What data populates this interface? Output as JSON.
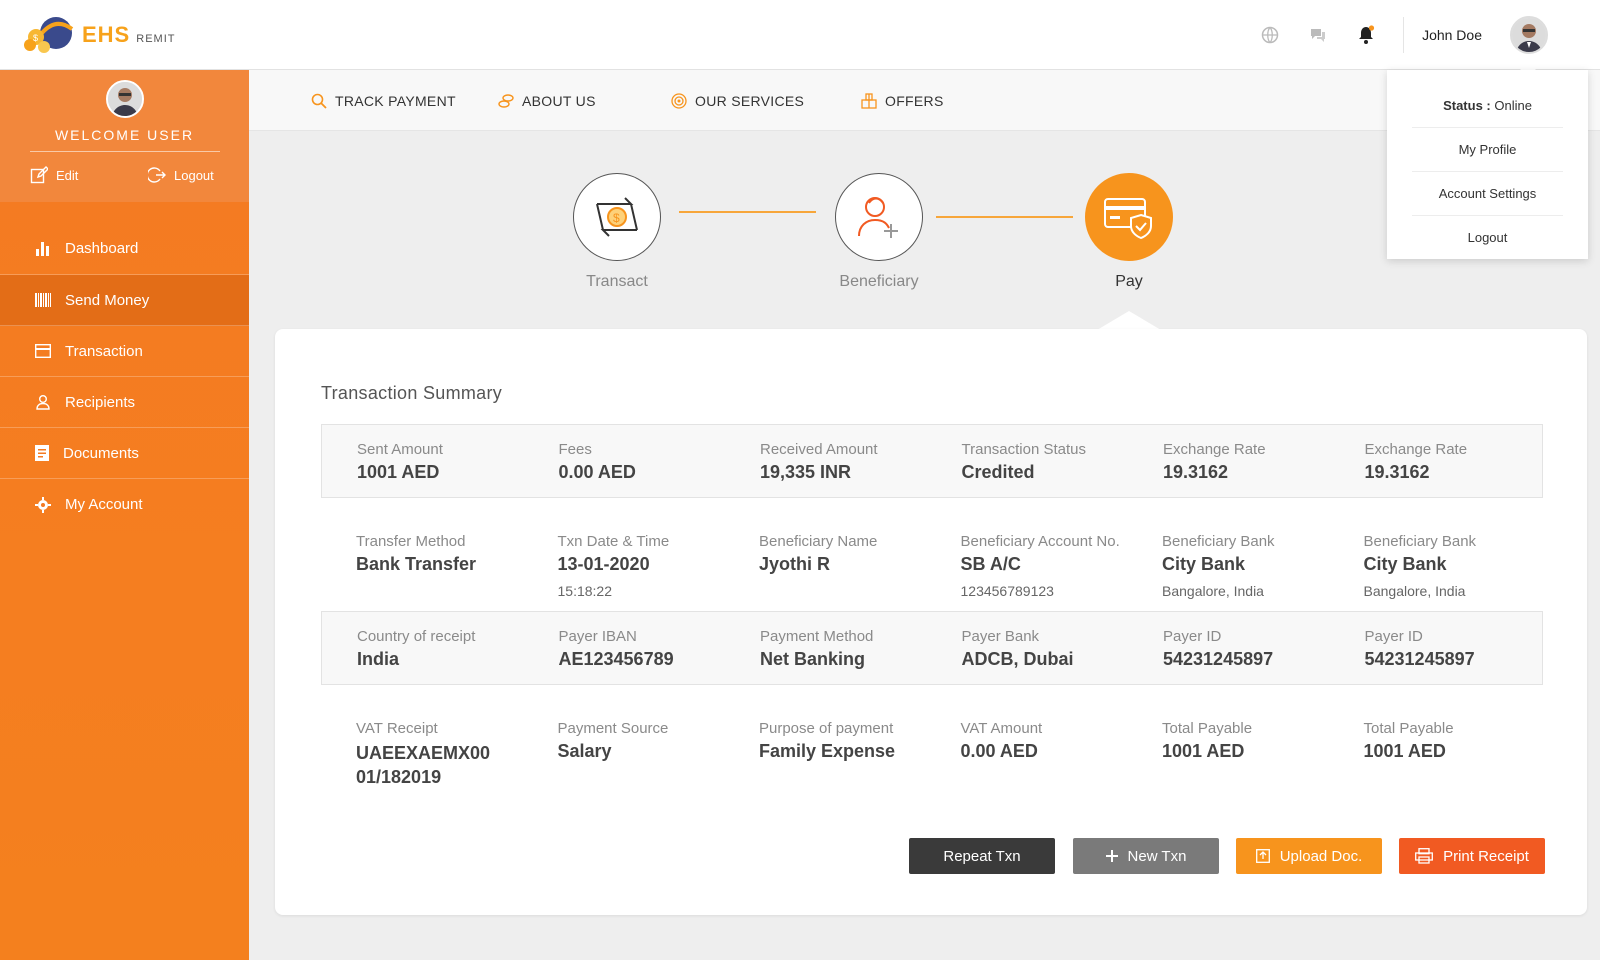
{
  "brand": {
    "name": "EHS",
    "sub": "REMIT"
  },
  "header": {
    "user_name": "John Doe",
    "icons": [
      "globe-icon",
      "chat-icon",
      "bell-icon"
    ]
  },
  "dropdown": {
    "status_label": "Status :",
    "status_value": "Online",
    "items": [
      "My Profile",
      "Account Settings",
      "Logout"
    ]
  },
  "sidebar": {
    "welcome": "WELCOME USER",
    "edit": "Edit",
    "logout": "Logout",
    "items": [
      {
        "label": "Dashboard",
        "icon": "bar-chart-icon"
      },
      {
        "label": "Send Money",
        "icon": "barcode-icon"
      },
      {
        "label": "Transaction",
        "icon": "card-icon"
      },
      {
        "label": "Recipients",
        "icon": "user-icon"
      },
      {
        "label": "Documents",
        "icon": "document-icon"
      },
      {
        "label": "My Account",
        "icon": "gear-icon"
      }
    ]
  },
  "nav": {
    "items": [
      {
        "label": "TRACK PAYMENT",
        "icon": "search-icon"
      },
      {
        "label": "ABOUT US",
        "icon": "coins-icon"
      },
      {
        "label": "OUR SERVICES",
        "icon": "target-icon"
      },
      {
        "label": "OFFERS",
        "icon": "gift-icon"
      }
    ]
  },
  "steps": [
    {
      "label": "Transact"
    },
    {
      "label": "Beneficiary"
    },
    {
      "label": "Pay"
    }
  ],
  "summary": {
    "title": "Transaction Summary",
    "rows": [
      [
        {
          "label": "Sent Amount",
          "value": "1001 AED",
          "sub": ""
        },
        {
          "label": "Fees",
          "value": "0.00 AED",
          "sub": ""
        },
        {
          "label": "Received Amount",
          "value": "19,335 INR",
          "sub": ""
        },
        {
          "label": "Transaction Status",
          "value": "Credited",
          "sub": ""
        },
        {
          "label": "Exchange Rate",
          "value": "19.3162",
          "sub": ""
        },
        {
          "label": "Exchange Rate",
          "value": "19.3162",
          "sub": ""
        }
      ],
      [
        {
          "label": "Transfer Method",
          "value": "Bank Transfer",
          "sub": ""
        },
        {
          "label": "Txn Date & Time",
          "value": "13-01-2020",
          "sub": "15:18:22"
        },
        {
          "label": "Beneficiary Name",
          "value": "Jyothi R",
          "sub": ""
        },
        {
          "label": "Beneficiary Account No.",
          "value": "SB A/C",
          "sub": "123456789123"
        },
        {
          "label": "Beneficiary Bank",
          "value": "City Bank",
          "sub": "Bangalore, India"
        },
        {
          "label": "Beneficiary Bank",
          "value": "City Bank",
          "sub": "Bangalore, India"
        }
      ],
      [
        {
          "label": "Country of receipt",
          "value": "India",
          "sub": ""
        },
        {
          "label": "Payer IBAN",
          "value": "AE123456789",
          "sub": ""
        },
        {
          "label": "Payment Method",
          "value": "Net Banking",
          "sub": ""
        },
        {
          "label": "Payer Bank",
          "value": "ADCB, Dubai",
          "sub": ""
        },
        {
          "label": "Payer ID",
          "value": "54231245897",
          "sub": ""
        },
        {
          "label": "Payer ID",
          "value": "54231245897",
          "sub": ""
        }
      ],
      [
        {
          "label": "VAT Receipt",
          "value": "UAEEXAEMX00 01/182019",
          "sub": ""
        },
        {
          "label": "Payment Source",
          "value": "Salary",
          "sub": ""
        },
        {
          "label": "Purpose of payment",
          "value": "Family Expense",
          "sub": ""
        },
        {
          "label": "VAT Amount",
          "value": "0.00 AED",
          "sub": ""
        },
        {
          "label": "Total Payable",
          "value": "1001 AED",
          "sub": ""
        },
        {
          "label": "Total Payable",
          "value": "1001 AED",
          "sub": ""
        }
      ]
    ]
  },
  "buttons": {
    "repeat": "Repeat Txn",
    "new": "New Txn",
    "upload": "Upload Doc.",
    "print": "Print Receipt"
  },
  "colors": {
    "accent": "#f47a22",
    "active_step": "#f7941d",
    "btn_dark": "#3a3a3a",
    "btn_gray": "#7a7a7a",
    "btn_orange": "#f7941d",
    "btn_red": "#f15a22"
  }
}
